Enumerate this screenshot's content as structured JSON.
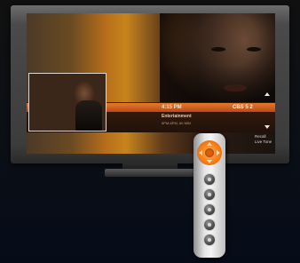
{
  "tv": {
    "info_bar": {
      "time": "4:15 PM",
      "channel": "CBS 5 2",
      "program_title": "Entertainment",
      "program_subtitle": "5PM-6PM, 60 MIN"
    },
    "options": {
      "line1": "Recall",
      "line2": "Live Tone"
    }
  },
  "remote": {
    "dpad_color": "#f47a14",
    "button_count": 5
  },
  "colors": {
    "accent_orange": "#e57a2a",
    "background": "#0b0f16"
  }
}
